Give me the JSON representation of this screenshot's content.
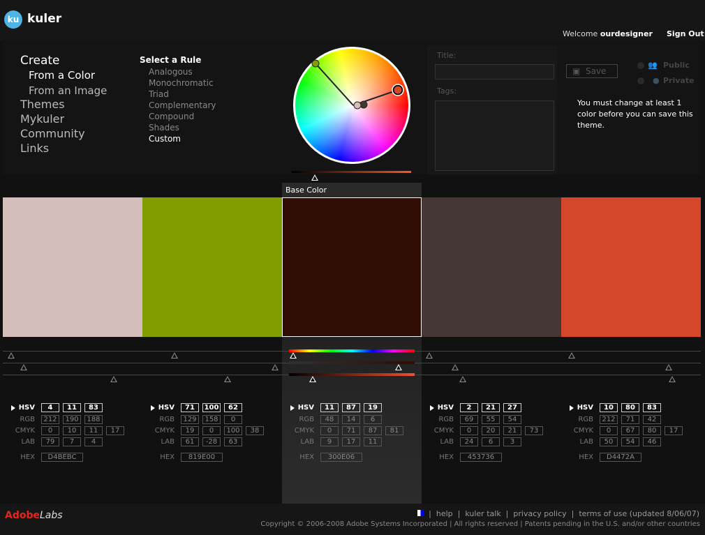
{
  "header": {
    "logo": "ku",
    "brand": "kuler",
    "welcome": "Welcome",
    "user": "ourdesigner",
    "signout": "Sign Out"
  },
  "nav": {
    "create": "Create",
    "from_color": "From a Color",
    "from_image": "From an Image",
    "themes": "Themes",
    "mykuler": "Mykuler",
    "community": "Community",
    "links": "Links"
  },
  "rules": {
    "title": "Select a Rule",
    "items": [
      "Analogous",
      "Monochromatic",
      "Triad",
      "Complementary",
      "Compound",
      "Shades",
      "Custom"
    ],
    "active": "Custom"
  },
  "form": {
    "title_label": "Title:",
    "tags_label": "Tags:",
    "save": "Save",
    "public": "Public",
    "private": "Private",
    "message": "You must  change at least 1 color before you can save this theme."
  },
  "base_color_label": "Base Color",
  "labels": {
    "hsv": "HSV",
    "rgb": "RGB",
    "cmyk": "CMYK",
    "lab": "LAB",
    "hex": "HEX"
  },
  "swatches": [
    {
      "color": "#D4BEBC",
      "hsv": [
        "4",
        "11",
        "83"
      ],
      "rgb": [
        "212",
        "190",
        "188"
      ],
      "cmyk": [
        "0",
        "10",
        "11",
        "17"
      ],
      "lab": [
        "79",
        "7",
        "4"
      ],
      "hex": "D4BEBC"
    },
    {
      "color": "#819E00",
      "hsv": [
        "71",
        "100",
        "62"
      ],
      "rgb": [
        "129",
        "158",
        "0"
      ],
      "cmyk": [
        "19",
        "0",
        "100",
        "38"
      ],
      "lab": [
        "61",
        "-28",
        "63"
      ],
      "hex": "819E00"
    },
    {
      "color": "#300E06",
      "hsv": [
        "11",
        "87",
        "19"
      ],
      "rgb": [
        "48",
        "14",
        "6"
      ],
      "cmyk": [
        "0",
        "71",
        "87",
        "81"
      ],
      "lab": [
        "9",
        "17",
        "11"
      ],
      "hex": "300E06",
      "selected": true
    },
    {
      "color": "#453736",
      "hsv": [
        "2",
        "21",
        "27"
      ],
      "rgb": [
        "69",
        "55",
        "54"
      ],
      "cmyk": [
        "0",
        "20",
        "21",
        "73"
      ],
      "lab": [
        "24",
        "6",
        "3"
      ],
      "hex": "453736"
    },
    {
      "color": "#D4472A",
      "hsv": [
        "10",
        "80",
        "83"
      ],
      "rgb": [
        "212",
        "71",
        "42"
      ],
      "cmyk": [
        "0",
        "67",
        "80",
        "17"
      ],
      "lab": [
        "50",
        "54",
        "46"
      ],
      "hex": "D4472A"
    }
  ],
  "footer": {
    "adobe": "Adobe",
    "labs": "Labs",
    "help": "help",
    "kuler_talk": "kuler talk",
    "privacy": "privacy policy",
    "terms": "terms of use (updated 8/06/07)",
    "copyright": "Copyright © 2006-2008 Adobe Systems Incorporated | All rights reserved | Patents pending in the U.S. and/or other countries"
  }
}
